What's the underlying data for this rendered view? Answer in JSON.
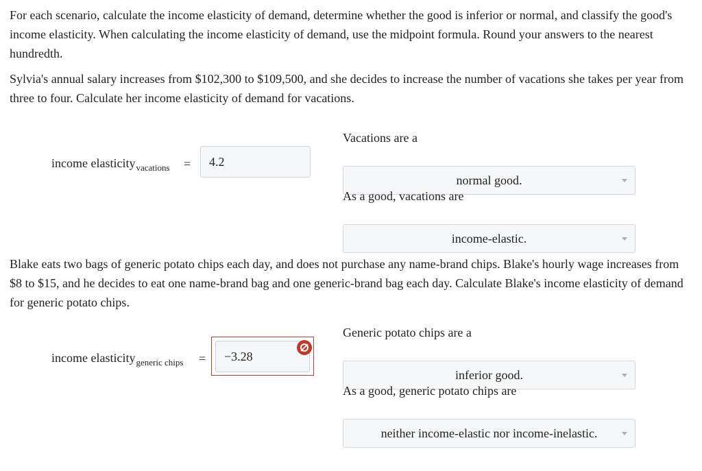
{
  "intro": "For each scenario, calculate the income elasticity of demand, determine whether the good is inferior or normal, and classify the good's income elasticity. When calculating the income elasticity of demand, use the midpoint formula. Round your answers to the nearest hundredth.",
  "scenario1": {
    "text": "Sylvia's annual salary increases from $102,300 to $109,500, and she decides to increase the number of vacations she takes per year from three to four. Calculate her income elasticity of demand for vacations.",
    "label_main": "income elasticity",
    "label_sub": "vacations",
    "equals": "=",
    "answer_value": "4.2",
    "prompt_type": "Vacations are a",
    "type_selected": "normal good.",
    "prompt_class": "As a good, vacations are",
    "class_selected": "income-elastic."
  },
  "scenario2": {
    "text": "Blake eats two bags of generic potato chips each day, and does not purchase any name-brand chips. Blake's hourly wage increases from $8 to $15, and he decides to eat one name-brand bag and one generic-brand bag each day. Calculate Blake's income elasticity of demand for generic potato chips.",
    "label_main": "income elasticity",
    "label_sub": "generic chips",
    "equals": "=",
    "answer_value": "−3.28",
    "answer_status": "incorrect",
    "prompt_type": "Generic potato chips are a",
    "type_selected": "inferior good.",
    "prompt_class": "As a good, generic potato chips are",
    "class_selected": "neither income-elastic nor income-inelastic."
  },
  "colors": {
    "error": "#c0392b",
    "field_bg": "#f5f6f7",
    "field_border": "#cfd4d8"
  },
  "icons": {
    "dropdown": "chevron-down-icon",
    "incorrect": "incorrect-icon"
  }
}
